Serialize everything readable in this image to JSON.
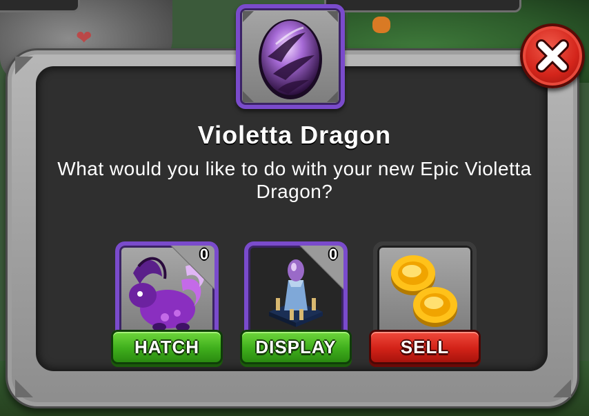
{
  "dialog": {
    "title": "Violetta Dragon",
    "prompt": "What would you like to do with your new Epic Violetta Dragon?",
    "egg_icon": "violetta-egg-icon",
    "close_icon": "close-x-icon"
  },
  "options": [
    {
      "id": "hatch",
      "label": "HATCH",
      "count": "0",
      "icon": "violetta-dragon-icon",
      "color": "#3fae1c"
    },
    {
      "id": "display",
      "label": "DISPLAY",
      "count": "0",
      "icon": "egg-display-pedestal-icon",
      "color": "#3fae1c"
    },
    {
      "id": "sell",
      "label": "SELL",
      "icon": "gold-coins-icon",
      "color": "#d22218"
    }
  ],
  "colors": {
    "epic_border": "#7a4bcc",
    "frame": "#a0a0a0",
    "panel": "#2f2f2f"
  }
}
